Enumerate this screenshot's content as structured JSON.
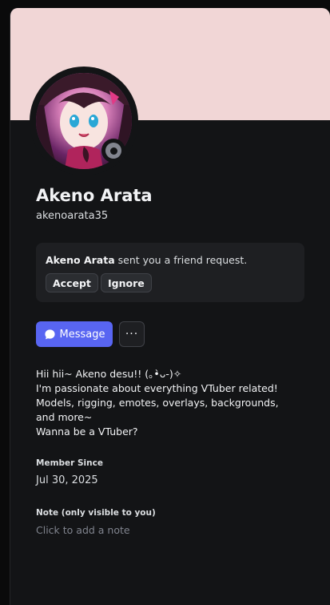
{
  "profile": {
    "display_name": "Akeno Arata",
    "username": "akenoarata35",
    "status_icon": "offline-status-icon"
  },
  "friend_request": {
    "sender": "Akeno Arata",
    "message": " sent you a friend request.",
    "accept_label": "Accept",
    "ignore_label": "Ignore"
  },
  "actions": {
    "message_label": "Message",
    "more_label": "···"
  },
  "bio": {
    "lines": [
      "Hii hii~ Akeno desu!! (｡•̀ᴗ-)✧",
      "I'm passionate about everything VTuber related!",
      "Models, rigging, emotes, overlays, backgrounds, and more~",
      "Wanna be a VTuber?"
    ]
  },
  "member_since": {
    "label": "Member Since",
    "value": "Jul 30, 2025"
  },
  "note": {
    "label": "Note (only visible to you)",
    "placeholder": "Click to add a note"
  },
  "colors": {
    "banner": "#f1d6d6",
    "card_bg": "#131416",
    "accent": "#5865f2",
    "status_offline": "#82858f"
  }
}
